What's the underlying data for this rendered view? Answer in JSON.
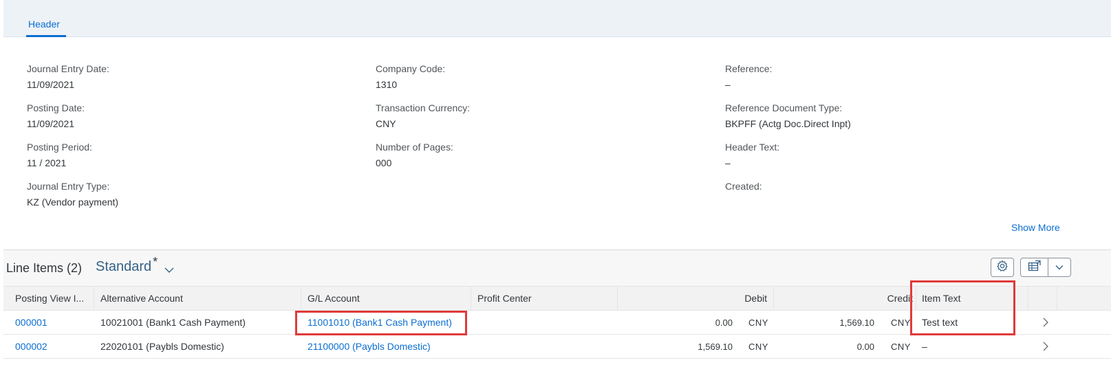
{
  "tab": {
    "label": "Header"
  },
  "header_fields": {
    "journal_entry_date": {
      "label": "Journal Entry Date:",
      "value": "11/09/2021"
    },
    "posting_date": {
      "label": "Posting Date:",
      "value": "11/09/2021"
    },
    "posting_period": {
      "label": "Posting Period:",
      "value": "11 / 2021"
    },
    "journal_entry_type": {
      "label": "Journal Entry Type:",
      "value": "KZ (Vendor payment)"
    },
    "company_code": {
      "label": "Company Code:",
      "value": "1310"
    },
    "transaction_currency": {
      "label": "Transaction Currency:",
      "value": "CNY"
    },
    "number_of_pages": {
      "label": "Number of Pages:",
      "value": "000"
    },
    "reference": {
      "label": "Reference:",
      "value": "–"
    },
    "reference_document_type": {
      "label": "Reference Document Type:",
      "value": "BKPFF (Actg Doc.Direct Inpt)"
    },
    "header_text": {
      "label": "Header Text:",
      "value": "–"
    },
    "created": {
      "label": "Created:",
      "value": ""
    }
  },
  "show_more": "Show More",
  "line_items": {
    "title": "Line Items (2)",
    "variant": "Standard",
    "variant_modified": "*",
    "columns": {
      "posting_view": "Posting View I...",
      "alternative_account": "Alternative Account",
      "gl_account": "G/L Account",
      "profit_center": "Profit Center",
      "debit": "Debit",
      "credit": "Credit",
      "item_text": "Item Text"
    },
    "rows": [
      {
        "posting_view": "000001",
        "alternative_account": "10021001 (Bank1 Cash Payment)",
        "gl_account": "11001010 (Bank1 Cash Payment)",
        "profit_center": "",
        "debit": "0.00",
        "debit_currency": "CNY",
        "credit": "1,569.10",
        "credit_currency": "CNY",
        "item_text": "Test text"
      },
      {
        "posting_view": "000002",
        "alternative_account": "22020101 (Paybls Domestic)",
        "gl_account": "21100000 (Paybls Domestic)",
        "profit_center": "",
        "debit": "1,569.10",
        "debit_currency": "CNY",
        "credit": "0.00",
        "credit_currency": "CNY",
        "item_text": "–"
      }
    ]
  },
  "colors": {
    "link": "#0a6ed1",
    "highlight": "#e03a3a",
    "header_bg": "#edf2f7"
  },
  "icons": {
    "settings": "gear-icon",
    "export": "spreadsheet-export-icon",
    "export_menu": "chevron-down-icon",
    "variant_menu": "chevron-down-icon",
    "row_navigation": "chevron-right-icon"
  }
}
